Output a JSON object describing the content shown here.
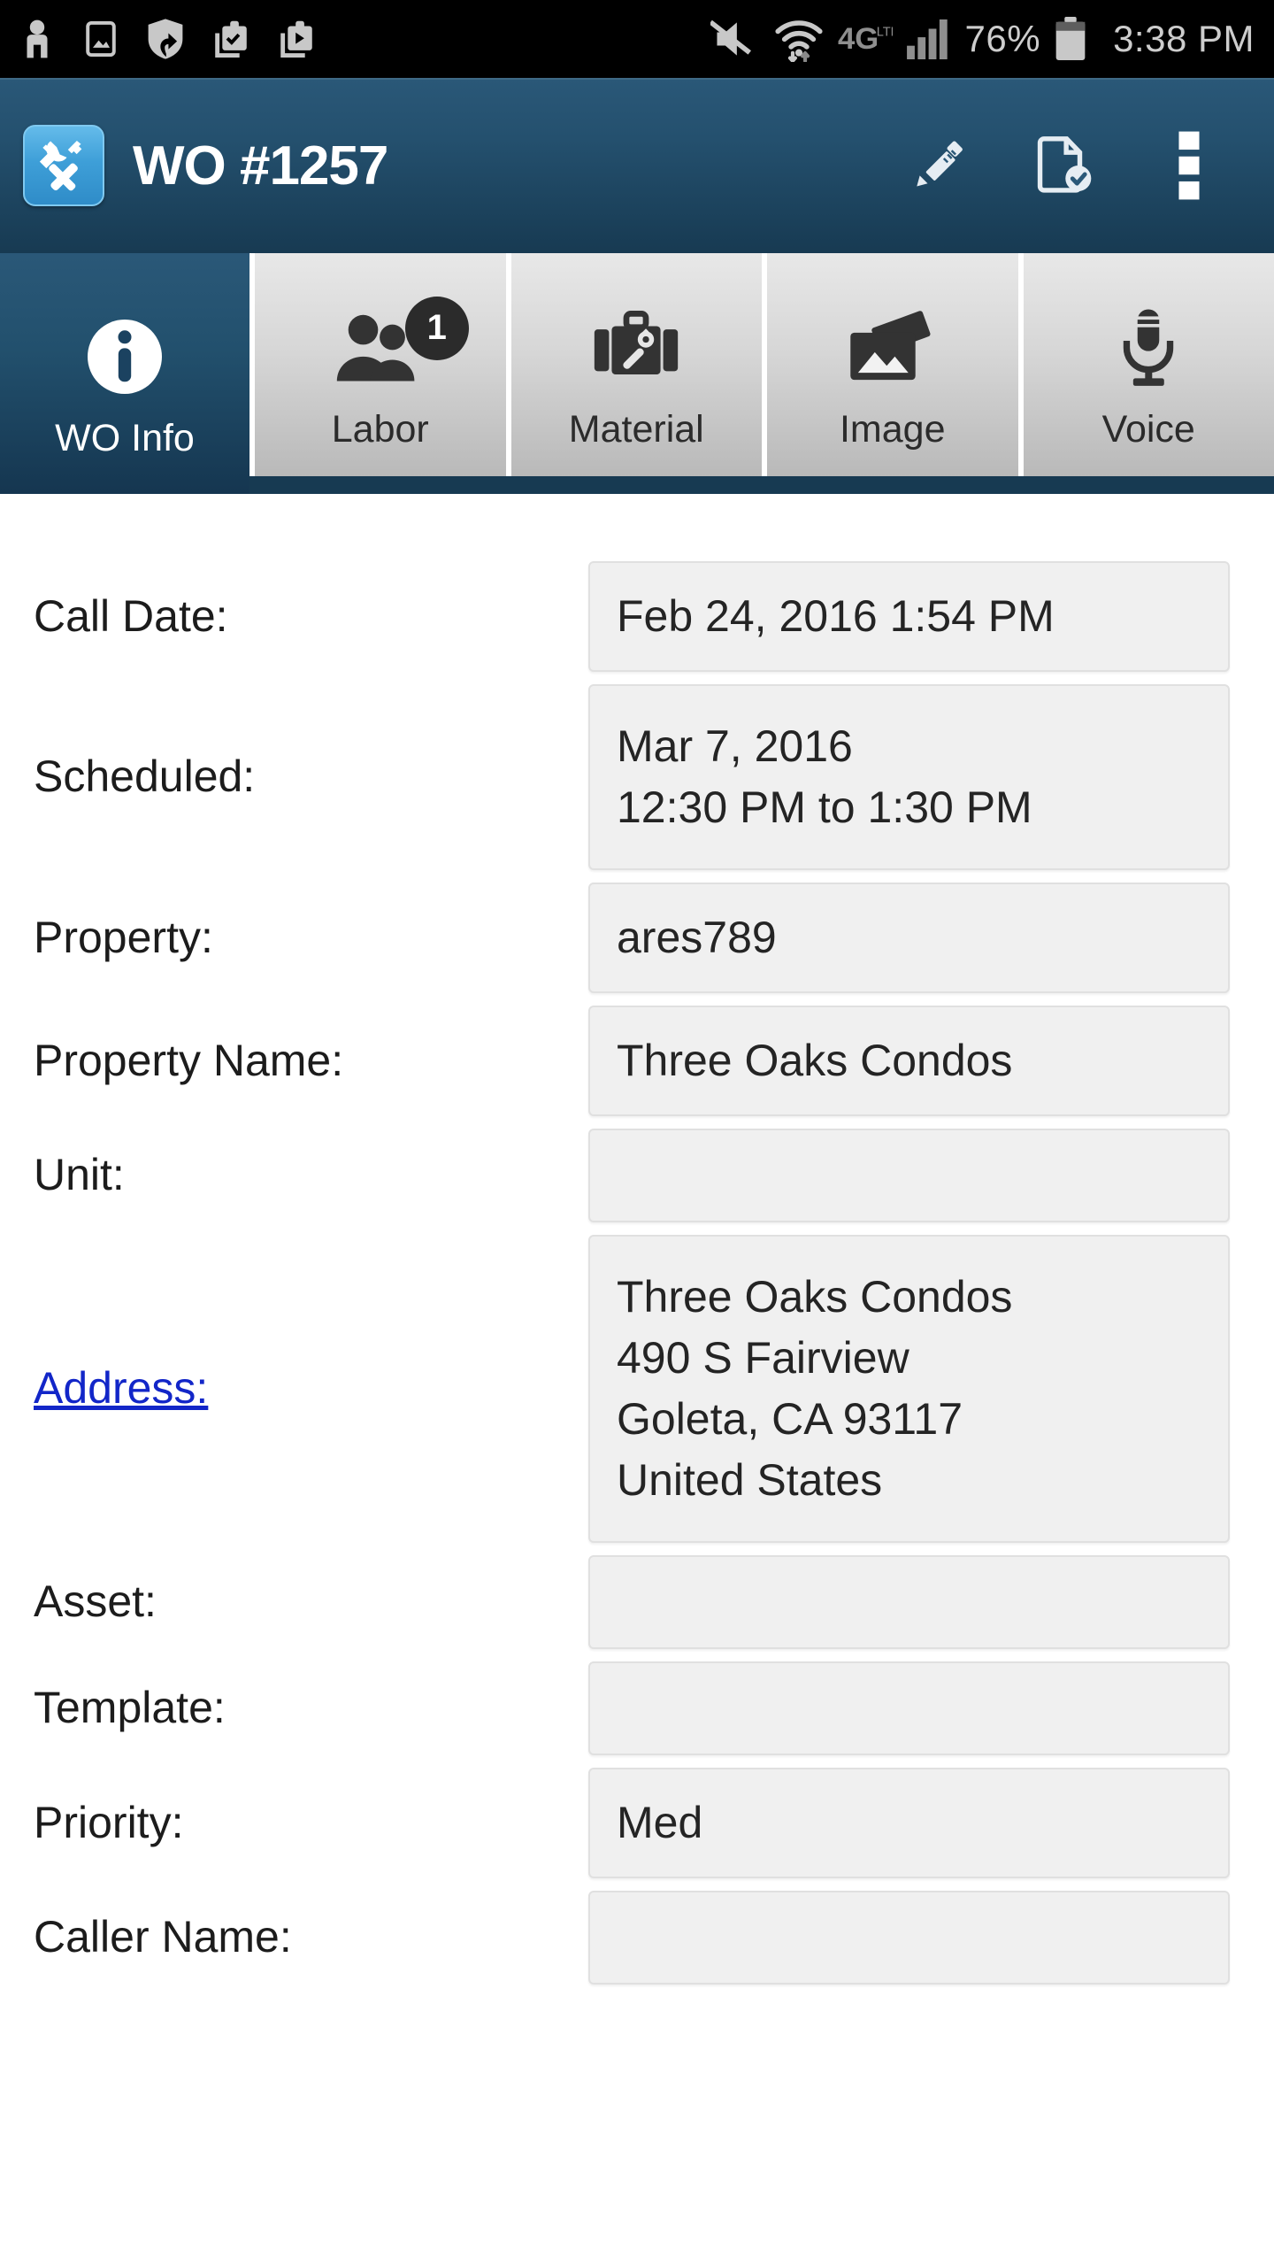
{
  "status_bar": {
    "icons_left": [
      "person-icon",
      "photo-icon",
      "shield-update-icon",
      "clipboard-check-icon",
      "clipboard-play-icon"
    ],
    "icons_right": [
      "mute-icon",
      "wifi-icon",
      "4glte-icon",
      "signal-bars-icon",
      "battery-icon"
    ],
    "network_label": "4G",
    "network_sub": "LTE",
    "battery_percent": "76%",
    "clock": "3:38 PM"
  },
  "header": {
    "app_icon": "wrench-hammer-icon",
    "title": "WO #1257",
    "actions": [
      {
        "name": "edit-button",
        "icon": "pencil-icon"
      },
      {
        "name": "complete-wo-button",
        "icon": "document-check-icon"
      },
      {
        "name": "overflow-menu-button",
        "icon": "more-vertical-icon"
      }
    ]
  },
  "tabs": [
    {
      "label": "WO Info",
      "icon": "info-circle-icon",
      "active": true,
      "badge": ""
    },
    {
      "label": "Labor",
      "icon": "people-icon",
      "active": false,
      "badge": "1"
    },
    {
      "label": "Material",
      "icon": "toolbox-icon",
      "active": false,
      "badge": ""
    },
    {
      "label": "Image",
      "icon": "photos-icon",
      "active": false,
      "badge": ""
    },
    {
      "label": "Voice",
      "icon": "microphone-icon",
      "active": false,
      "badge": ""
    }
  ],
  "form": {
    "fields": [
      {
        "label": "Call Date:",
        "value": "Feb 24, 2016 1:54 PM",
        "link": false,
        "multiline": false
      },
      {
        "label": "Scheduled:",
        "value": "Mar 7, 2016\n12:30 PM to 1:30 PM",
        "link": false,
        "multiline": true
      },
      {
        "label": "Property:",
        "value": "ares789",
        "link": false,
        "multiline": false
      },
      {
        "label": "Property Name:",
        "value": "Three Oaks Condos",
        "link": false,
        "multiline": false
      },
      {
        "label": "Unit:",
        "value": "",
        "link": false,
        "multiline": false
      },
      {
        "label": "Address:",
        "value": "Three Oaks Condos\n490 S Fairview\nGoleta, CA 93117\nUnited States",
        "link": true,
        "multiline": true
      },
      {
        "label": "Asset:",
        "value": "",
        "link": false,
        "multiline": false
      },
      {
        "label": "Template:",
        "value": "",
        "link": false,
        "multiline": false
      },
      {
        "label": "Priority:",
        "value": "Med",
        "link": false,
        "multiline": false
      },
      {
        "label": "Caller Name:",
        "value": "",
        "link": false,
        "multiline": false
      }
    ]
  },
  "colors": {
    "header_blue": "#173a52",
    "header_blue_light": "#2a5878",
    "app_icon_blue": "#3e9fd8",
    "tab_inactive": "#d6d6d6",
    "field_bg": "#f0f0f0",
    "link_blue": "#1226c8",
    "badge_dark": "#2b2b2b",
    "status_bar_bg": "#000000"
  }
}
